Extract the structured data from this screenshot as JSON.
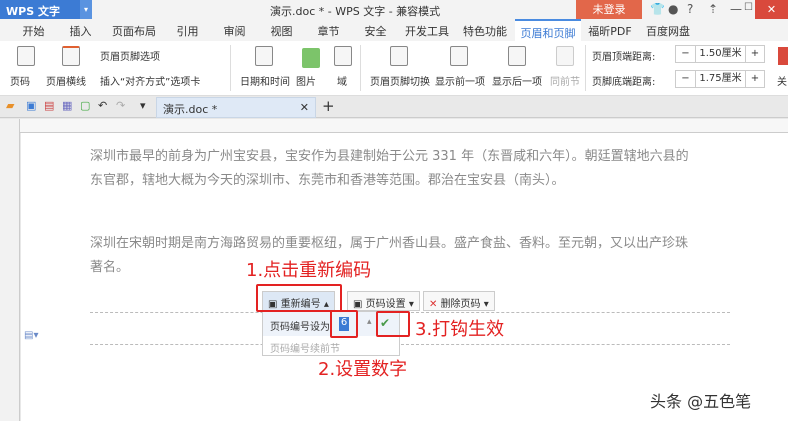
{
  "app": {
    "name": "WPS 文字",
    "title": "演示.doc * - WPS 文字 - 兼容模式",
    "login": "未登录",
    "help": "?"
  },
  "tabs": [
    "开始",
    "插入",
    "页面布局",
    "引用",
    "审阅",
    "视图",
    "章节",
    "安全",
    "开发工具",
    "特色功能",
    "页眉和页脚",
    "福昕PDF",
    "百度网盘"
  ],
  "ribbon": {
    "page_num": "页码",
    "header_line": "页眉横线",
    "hf_options": "页眉页脚选项",
    "insert_align": "插入“对齐方式”选项卡",
    "datetime": "日期和时间",
    "picture": "图片",
    "field": "域",
    "hf_switch": "页眉页脚切换",
    "show_prev": "显示前一项",
    "show_next": "显示后一项",
    "same_prev": "同前节",
    "header_top_label": "页眉顶端距离:",
    "header_top_value": "1.50厘米",
    "footer_bottom_label": "页脚底端距离:",
    "footer_bottom_value": "1.75厘米",
    "close": "关"
  },
  "doc_tab": "演示.doc *",
  "body": {
    "p1": "深圳市最早的前身为广州宝安县，宝安作为县建制始于公元 331 年（东晋咸和六年）。朝廷置辖地六县的东官郡，辖地大概为今天的深圳市、东莞市和香港等范围。郡治在宝安县（南头）。",
    "p2": "深圳在宋朝时期是南方海路贸易的重要枢纽，属于广州香山县。盛产食盐、香料。至元朝，又以出产珍珠著名。"
  },
  "footer_toolbar": {
    "renumber": "重新编号",
    "page_settings": "页码设置",
    "delete_page_num": "删除页码",
    "set_label": "页码编号设为",
    "set_value": "6",
    "continue_label": "页码编号续前节"
  },
  "annotations": {
    "a1": "1.点击重新编码",
    "a2": "2.设置数字",
    "a3": "3.打钩生效"
  },
  "watermark": "头条 @五色笔"
}
